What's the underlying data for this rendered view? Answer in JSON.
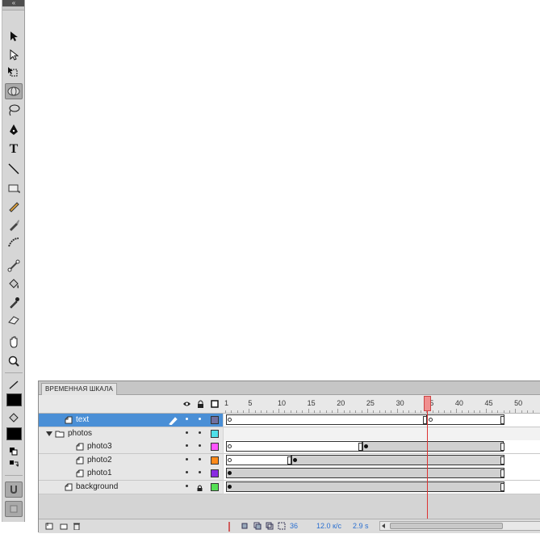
{
  "tools_panel": {
    "collapse_glyph": "«",
    "tools": [
      {
        "name": "selection-tool-icon"
      },
      {
        "name": "subselection-tool-icon"
      },
      {
        "name": "free-transform-tool-icon"
      },
      {
        "name": "3d-rotation-tool-icon"
      },
      {
        "name": "lasso-tool-icon"
      },
      {
        "name": "pen-tool-icon"
      },
      {
        "name": "text-tool-icon",
        "glyph": "T"
      },
      {
        "name": "line-tool-icon"
      },
      {
        "name": "rectangle-tool-icon"
      },
      {
        "name": "pencil-tool-icon"
      },
      {
        "name": "brush-tool-icon"
      },
      {
        "name": "deco-tool-icon"
      },
      {
        "name": "bone-tool-icon"
      },
      {
        "name": "paint-bucket-tool-icon"
      },
      {
        "name": "eyedropper-tool-icon"
      },
      {
        "name": "eraser-tool-icon"
      },
      {
        "name": "hand-tool-icon"
      },
      {
        "name": "zoom-tool-icon"
      }
    ],
    "stroke_color": "#000000",
    "fill_color": "#000000",
    "snap_icon": "magnet-icon"
  },
  "timeline": {
    "tab_label": "ВРЕМЕННАЯ ШКАЛА",
    "ruler": [
      "1",
      "5",
      "10",
      "15",
      "20",
      "25",
      "30",
      "35",
      "40",
      "45",
      "50"
    ],
    "playhead_frame": 35,
    "layers": [
      {
        "name": "text",
        "color": "#6f6f9f",
        "indent": 1,
        "active": true,
        "locked": false
      },
      {
        "name": "photos",
        "color": "#4fe0e8",
        "indent": 0,
        "folder": true,
        "locked": false
      },
      {
        "name": "photo3",
        "color": "#ff55ff",
        "indent": 2,
        "locked": false
      },
      {
        "name": "photo2",
        "color": "#ff8a1a",
        "indent": 2,
        "locked": false
      },
      {
        "name": "photo1",
        "color": "#8a2be2",
        "indent": 2,
        "locked": false
      },
      {
        "name": "background",
        "color": "#55e055",
        "indent": 1,
        "locked": true
      }
    ],
    "footer": {
      "current_frame": "36",
      "frame_rate": "12.0 к/с",
      "elapsed": "2.9 s"
    }
  }
}
